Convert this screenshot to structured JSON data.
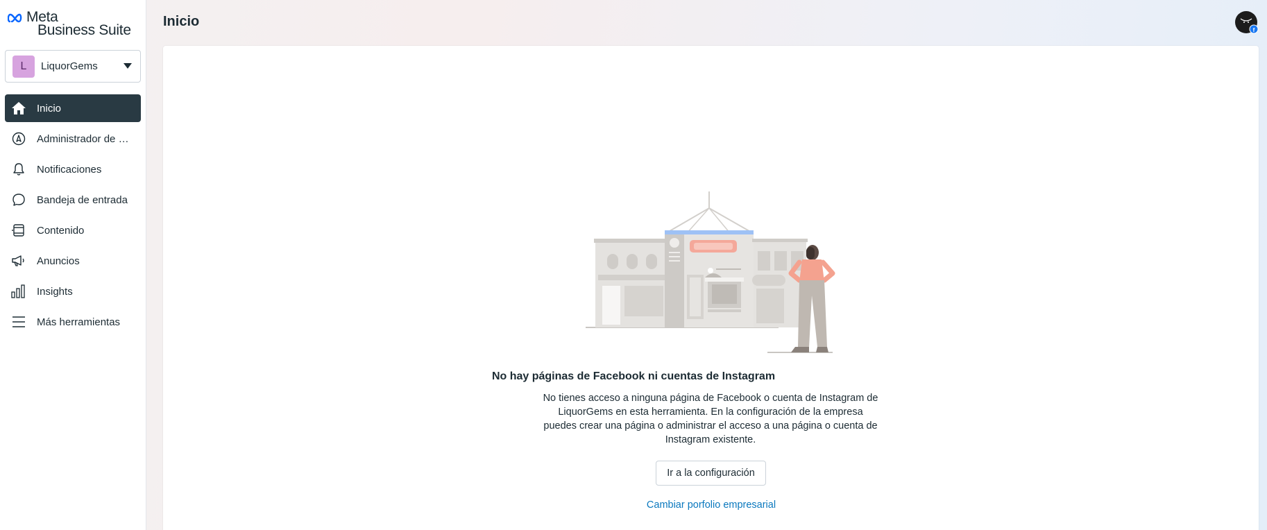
{
  "app": {
    "brand_line1": "Meta",
    "brand_line2": "Business Suite"
  },
  "account": {
    "initial": "L",
    "name": "LiquorGems"
  },
  "sidebar": {
    "items": [
      {
        "label": "Inicio",
        "icon": "home-icon",
        "active": true
      },
      {
        "label": "Administrador de anuncios",
        "icon": "compass-icon"
      },
      {
        "label": "Notificaciones",
        "icon": "bell-icon"
      },
      {
        "label": "Bandeja de entrada",
        "icon": "chat-bubble-icon"
      },
      {
        "label": "Contenido",
        "icon": "content-icon"
      },
      {
        "label": "Anuncios",
        "icon": "megaphone-icon"
      },
      {
        "label": "Insights",
        "icon": "bar-chart-icon"
      },
      {
        "label": "Más herramientas",
        "icon": "menu-icon"
      }
    ]
  },
  "header": {
    "title": "Inicio"
  },
  "empty_state": {
    "title": "No hay páginas de Facebook ni cuentas de Instagram",
    "description": "No tienes acceso a ninguna página de Facebook o cuenta de Instagram de LiquorGems en esta herramienta. En la configuración de la empresa puedes crear una página o administrar el acceso a una página o cuenta de Instagram existente.",
    "primary_button": "Ir a la configuración",
    "secondary_link": "Cambiar porfolio empresarial"
  },
  "colors": {
    "sidebar_active_bg": "#293a43",
    "link": "#0a78be",
    "avatar_bg": "#d7a3df",
    "facebook_badge": "#1877f2"
  }
}
